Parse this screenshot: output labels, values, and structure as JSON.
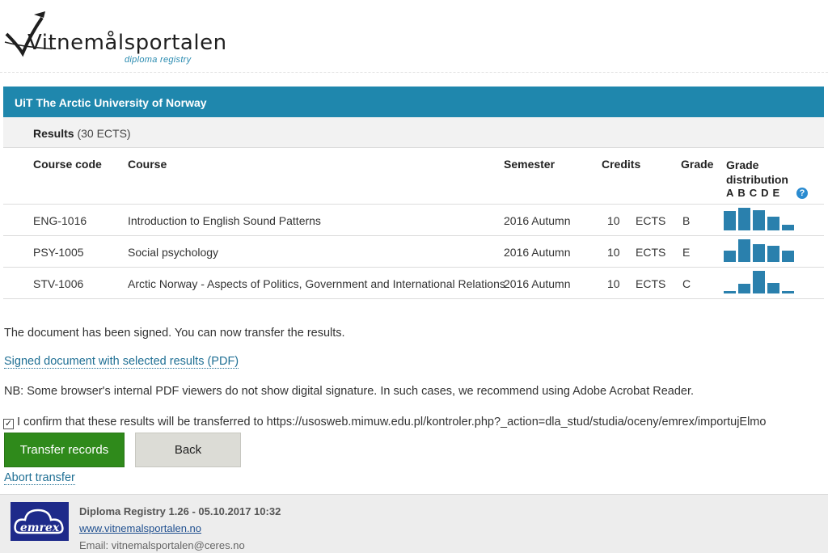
{
  "header": {
    "logo_text": "Vitnemålsportalen",
    "logo_subtitle": "diploma registry"
  },
  "institution": "UiT The Arctic University of Norway",
  "results": {
    "label": "Results",
    "ects": "(30 ECTS)"
  },
  "columns": {
    "code": "Course code",
    "course": "Course",
    "semester": "Semester",
    "credits": "Credits",
    "grade": "Grade",
    "distribution": "Grade distribution",
    "letters": "ABCDE",
    "help": "?"
  },
  "rows": [
    {
      "code": "ENG-1016",
      "course": "Introduction to English Sound Patterns",
      "semester": "2016 Autumn",
      "credits": "10",
      "unit": "ECTS",
      "grade": "B",
      "distribution": [
        0.85,
        1.0,
        0.9,
        0.6,
        0.25
      ]
    },
    {
      "code": "PSY-1005",
      "course": "Social psychology",
      "semester": "2016 Autumn",
      "credits": "10",
      "unit": "ECTS",
      "grade": "E",
      "distribution": [
        0.5,
        1.0,
        0.8,
        0.7,
        0.5
      ]
    },
    {
      "code": "STV-1006",
      "course": "Arctic Norway - Aspects of Politics, Government and International Relations",
      "semester": "2016 Autumn",
      "credits": "10",
      "unit": "ECTS",
      "grade": "C",
      "distribution": [
        0.12,
        0.42,
        1.0,
        0.45,
        0.06
      ]
    }
  ],
  "messages": {
    "signed": "The document has been signed. You can now transfer the results.",
    "pdf_link": "Signed document with selected results (PDF)",
    "nb": "NB: Some browser's internal PDF viewers do not show digital signature. In such cases, we recommend using Adobe Acrobat Reader.",
    "confirm": "I confirm that these results will be transferred to https://usosweb.mimuw.edu.pl/kontroler.php?_action=dla_stud/studia/oceny/emrex/importujElmo",
    "checkbox_mark": "✓"
  },
  "buttons": {
    "transfer": "Transfer records",
    "back": "Back",
    "abort": "Abort transfer"
  },
  "footer": {
    "logo_text": "emrex",
    "title": "Diploma Registry 1.26 - 05.10.2017 10:32",
    "link": "www.vitnemalsportalen.no",
    "email": "Email: vitnemalsportalen@ceres.no"
  },
  "colors": {
    "header_bar": "#1f87ad",
    "bar_fill": "#2a80ad",
    "transfer_button": "#2f8a1b",
    "link": "#1f6f94"
  }
}
